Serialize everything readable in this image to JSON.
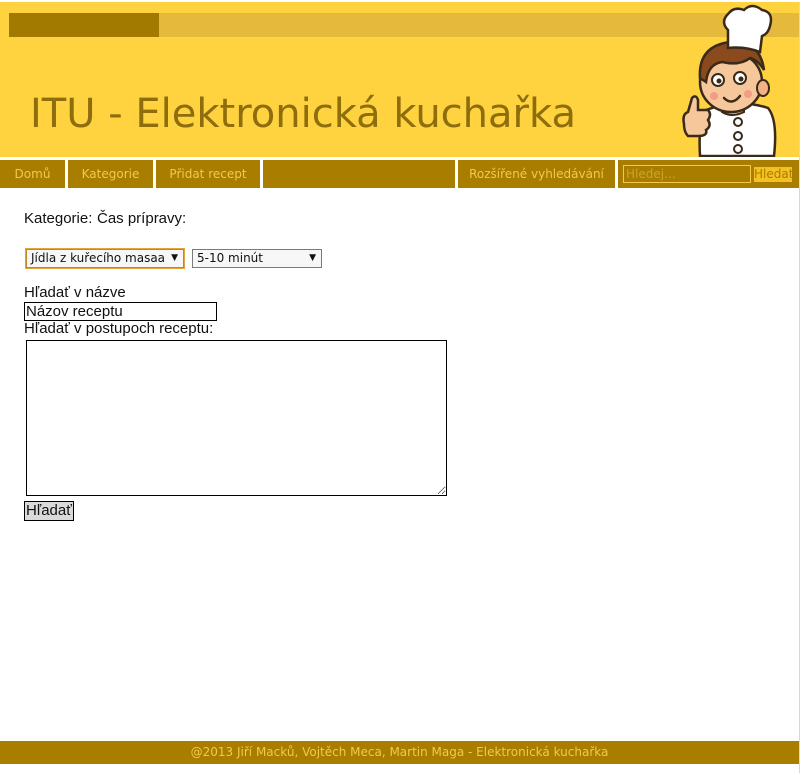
{
  "header": {
    "title": "ITU - Elektronická kuchařka",
    "logo_icon": "chef-mascot-icon"
  },
  "nav": {
    "items": [
      {
        "label": "Domů"
      },
      {
        "label": "Kategorie"
      },
      {
        "label": "Přidat recept"
      },
      {
        "label": ""
      },
      {
        "label": "Rozšířené vyhledávání"
      }
    ],
    "search_placeholder": "Hledej...",
    "search_value": "",
    "search_button": "Hledat"
  },
  "form": {
    "category_label": "Kategorie:",
    "time_label": "Čas prípravy:",
    "category_selected": "Jídla z kuřecího masaa",
    "time_selected": "5-10 minút",
    "name_label": "Hľadať v názve",
    "name_value": "Názov receptu",
    "steps_label": "Hľadať v postupoch receptu:",
    "steps_value": "",
    "submit_label": "Hľadať"
  },
  "footer": {
    "text": "@2013 Jiří Macků, Vojtěch Meca, Martin Maga - Elektronická kuchařka"
  },
  "colors": {
    "header_background": "#ffd23f",
    "nav_background": "#a97e00",
    "nav_text": "#f2c94b",
    "title_text": "#8d6d0c"
  }
}
